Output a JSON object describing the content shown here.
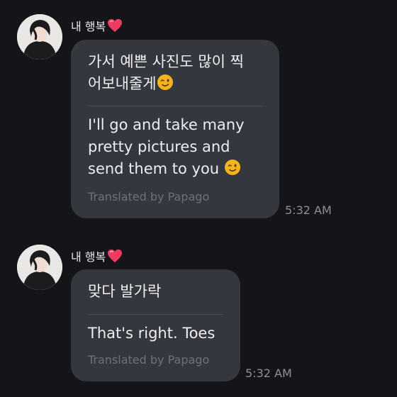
{
  "messages": [
    {
      "sender": "내 행복",
      "sender_emoji": "heart",
      "original_line1": "가서 예쁜 사진도 많이 찍",
      "original_line2": "어보내줄게",
      "original_emoji": "wink",
      "translated_line1": "I'll go and take many",
      "translated_line2": "pretty pictures and",
      "translated_line3": "send them to you",
      "translated_emoji": "wink",
      "credit": "Translated by Papago",
      "time": "5:32 AM"
    },
    {
      "sender": "내 행복",
      "sender_emoji": "heart",
      "original_line1": "맞다 발가락",
      "translated_line1": "That's right. Toes",
      "credit": "Translated by Papago",
      "time": "5:32 AM"
    }
  ],
  "colors": {
    "background": "#151519",
    "bubble": "#35373e",
    "heart": "#ee3b62",
    "wink": "#f6b51f"
  }
}
